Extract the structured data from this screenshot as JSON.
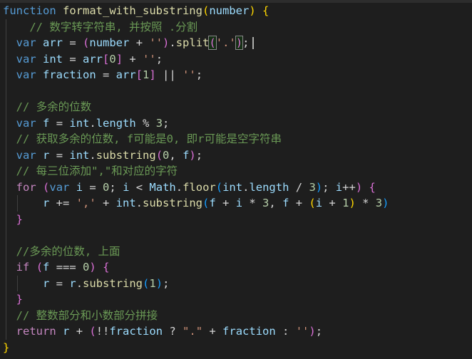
{
  "editor": {
    "language": "javascript",
    "theme": "dark",
    "background": "#1e1e1e",
    "tab_strip_text": "…"
  },
  "code_lines": [
    [
      [
        "kw",
        "function"
      ],
      [
        "op",
        " "
      ],
      [
        "fn",
        "format_with_substring"
      ],
      [
        "b1",
        "("
      ],
      [
        "var",
        "number"
      ],
      [
        "b1",
        ")"
      ],
      [
        "op",
        " "
      ],
      [
        "b1",
        "{"
      ]
    ],
    [
      [
        "op",
        "    "
      ],
      [
        "com",
        "// 数字转字符串, 并按照 .分割"
      ]
    ],
    [
      [
        "op",
        "  "
      ],
      [
        "kw",
        "var"
      ],
      [
        "op",
        " "
      ],
      [
        "var",
        "arr"
      ],
      [
        "op",
        " = "
      ],
      [
        "b2",
        "("
      ],
      [
        "var",
        "number"
      ],
      [
        "op",
        " + "
      ],
      [
        "str",
        "''"
      ],
      [
        "b2",
        ")"
      ],
      [
        "op",
        "."
      ],
      [
        "fn",
        "split"
      ],
      [
        "b2m",
        "("
      ],
      [
        "str",
        "'.'"
      ],
      [
        "b2m",
        ")"
      ],
      [
        "op",
        ";"
      ]
    ],
    [
      [
        "op",
        "  "
      ],
      [
        "kw",
        "var"
      ],
      [
        "op",
        " "
      ],
      [
        "var",
        "int"
      ],
      [
        "op",
        " = "
      ],
      [
        "var",
        "arr"
      ],
      [
        "b2",
        "["
      ],
      [
        "num",
        "0"
      ],
      [
        "b2",
        "]"
      ],
      [
        "op",
        " + "
      ],
      [
        "str",
        "''"
      ],
      [
        "op",
        ";"
      ]
    ],
    [
      [
        "op",
        "  "
      ],
      [
        "kw",
        "var"
      ],
      [
        "op",
        " "
      ],
      [
        "var",
        "fraction"
      ],
      [
        "op",
        " = "
      ],
      [
        "var",
        "arr"
      ],
      [
        "b2",
        "["
      ],
      [
        "num",
        "1"
      ],
      [
        "b2",
        "]"
      ],
      [
        "op",
        " || "
      ],
      [
        "str",
        "''"
      ],
      [
        "op",
        ";"
      ]
    ],
    [],
    [
      [
        "op",
        "  "
      ],
      [
        "com",
        "// 多余的位数"
      ]
    ],
    [
      [
        "op",
        "  "
      ],
      [
        "kw",
        "var"
      ],
      [
        "op",
        " "
      ],
      [
        "var",
        "f"
      ],
      [
        "op",
        " = "
      ],
      [
        "var",
        "int"
      ],
      [
        "op",
        "."
      ],
      [
        "var",
        "length"
      ],
      [
        "op",
        " % "
      ],
      [
        "num",
        "3"
      ],
      [
        "op",
        ";"
      ]
    ],
    [
      [
        "op",
        "  "
      ],
      [
        "com",
        "// 获取多余的位数, f可能是0, 即r可能是空字符串"
      ]
    ],
    [
      [
        "op",
        "  "
      ],
      [
        "kw",
        "var"
      ],
      [
        "op",
        " "
      ],
      [
        "var",
        "r"
      ],
      [
        "op",
        " = "
      ],
      [
        "var",
        "int"
      ],
      [
        "op",
        "."
      ],
      [
        "fn",
        "substring"
      ],
      [
        "b2",
        "("
      ],
      [
        "num",
        "0"
      ],
      [
        "op",
        ", "
      ],
      [
        "var",
        "f"
      ],
      [
        "b2",
        ")"
      ],
      [
        "op",
        ";"
      ]
    ],
    [
      [
        "op",
        "  "
      ],
      [
        "com",
        "// 每三位添加\",\"和对应的字符"
      ]
    ],
    [
      [
        "op",
        "  "
      ],
      [
        "ctl",
        "for"
      ],
      [
        "op",
        " "
      ],
      [
        "b2",
        "("
      ],
      [
        "kw",
        "var"
      ],
      [
        "op",
        " "
      ],
      [
        "var",
        "i"
      ],
      [
        "op",
        " = "
      ],
      [
        "num",
        "0"
      ],
      [
        "op",
        "; "
      ],
      [
        "var",
        "i"
      ],
      [
        "op",
        " < "
      ],
      [
        "var",
        "Math"
      ],
      [
        "op",
        "."
      ],
      [
        "fn",
        "floor"
      ],
      [
        "b3",
        "("
      ],
      [
        "var",
        "int"
      ],
      [
        "op",
        "."
      ],
      [
        "var",
        "length"
      ],
      [
        "op",
        " / "
      ],
      [
        "num",
        "3"
      ],
      [
        "b3",
        ")"
      ],
      [
        "op",
        "; "
      ],
      [
        "var",
        "i"
      ],
      [
        "op",
        "++"
      ],
      [
        "b2",
        ")"
      ],
      [
        "op",
        " "
      ],
      [
        "b2",
        "{"
      ]
    ],
    [
      [
        "op",
        "      "
      ],
      [
        "var",
        "r"
      ],
      [
        "op",
        " += "
      ],
      [
        "str",
        "','"
      ],
      [
        "op",
        " + "
      ],
      [
        "var",
        "int"
      ],
      [
        "op",
        "."
      ],
      [
        "fn",
        "substring"
      ],
      [
        "b3",
        "("
      ],
      [
        "var",
        "f"
      ],
      [
        "op",
        " + "
      ],
      [
        "var",
        "i"
      ],
      [
        "op",
        " * "
      ],
      [
        "num",
        "3"
      ],
      [
        "op",
        ", "
      ],
      [
        "var",
        "f"
      ],
      [
        "op",
        " + "
      ],
      [
        "b1",
        "("
      ],
      [
        "var",
        "i"
      ],
      [
        "op",
        " + "
      ],
      [
        "num",
        "1"
      ],
      [
        "b1",
        ")"
      ],
      [
        "op",
        " * "
      ],
      [
        "num",
        "3"
      ],
      [
        "b3",
        ")"
      ]
    ],
    [
      [
        "op",
        "  "
      ],
      [
        "b2",
        "}"
      ]
    ],
    [],
    [
      [
        "op",
        "  "
      ],
      [
        "com",
        "//多余的位数, 上面"
      ]
    ],
    [
      [
        "op",
        "  "
      ],
      [
        "ctl",
        "if"
      ],
      [
        "op",
        " "
      ],
      [
        "b2",
        "("
      ],
      [
        "var",
        "f"
      ],
      [
        "op",
        " === "
      ],
      [
        "num",
        "0"
      ],
      [
        "b2",
        ")"
      ],
      [
        "op",
        " "
      ],
      [
        "b2",
        "{"
      ]
    ],
    [
      [
        "op",
        "      "
      ],
      [
        "var",
        "r"
      ],
      [
        "op",
        " = "
      ],
      [
        "var",
        "r"
      ],
      [
        "op",
        "."
      ],
      [
        "fn",
        "substring"
      ],
      [
        "b3",
        "("
      ],
      [
        "num",
        "1"
      ],
      [
        "b3",
        ")"
      ],
      [
        "op",
        ";"
      ]
    ],
    [
      [
        "op",
        "  "
      ],
      [
        "b2",
        "}"
      ]
    ],
    [
      [
        "op",
        "  "
      ],
      [
        "com",
        "// 整数部分和小数部分拼接"
      ]
    ],
    [
      [
        "op",
        "  "
      ],
      [
        "ctl",
        "return"
      ],
      [
        "op",
        " "
      ],
      [
        "var",
        "r"
      ],
      [
        "op",
        " + "
      ],
      [
        "b2",
        "("
      ],
      [
        "op",
        "!!"
      ],
      [
        "var",
        "fraction"
      ],
      [
        "op",
        " ? "
      ],
      [
        "str",
        "\".\""
      ],
      [
        "op",
        " + "
      ],
      [
        "var",
        "fraction"
      ],
      [
        "op",
        " : "
      ],
      [
        "str",
        "''"
      ],
      [
        "b2",
        ")"
      ],
      [
        "op",
        ";"
      ]
    ],
    [
      [
        "b1",
        "}"
      ]
    ]
  ]
}
